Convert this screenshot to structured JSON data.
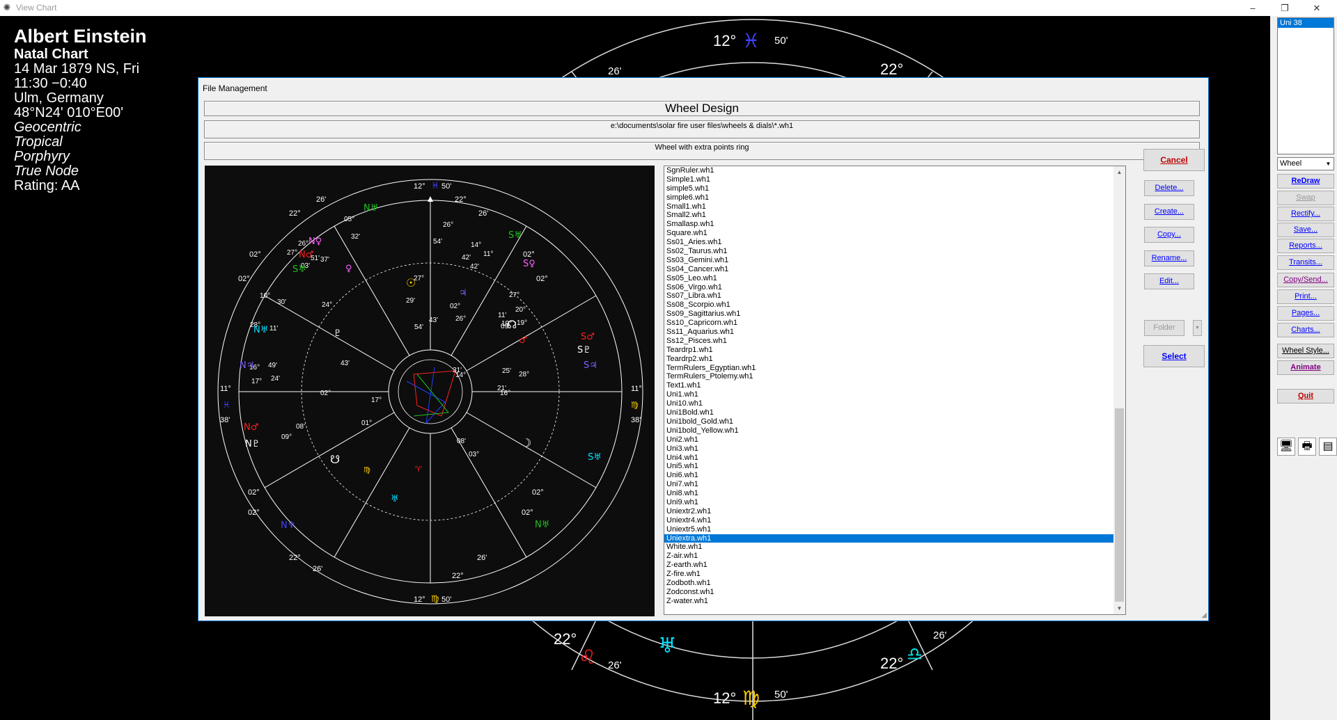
{
  "window": {
    "title": "View Chart",
    "minimize": "–",
    "restore": "❐",
    "close": "✕"
  },
  "chart_info": {
    "name": "Albert Einstein",
    "type": "Natal Chart",
    "date": "14 Mar 1879 NS, Fri",
    "time": "11:30  −0:40",
    "place": "Ulm, Germany",
    "coords": "48°N24' 010°E00'",
    "perspective": "Geocentric",
    "zodiac": "Tropical",
    "houses": "Porphyry",
    "node": "True Node",
    "rating": "Rating: AA"
  },
  "bg_wheel": {
    "top_deg": "12°",
    "top_min": "50'",
    "top_sign": "♓",
    "top_left": "26'",
    "top_right": "22°",
    "bottom_deg": "12°",
    "bottom_min": "50'",
    "bottom_sign": "♍",
    "bl_deg": "22°",
    "bl_sign": "♌",
    "bl_min": "26'",
    "bm_sign": "♅",
    "br_deg": "22°",
    "br_sign": "♎",
    "br_min": "26'"
  },
  "right_panel": {
    "listbox_selected": "Uni 38",
    "wheel_select": "Wheel",
    "buttons": {
      "redraw": "ReDraw",
      "swap": "Swap",
      "rectify": "Rectify...",
      "save": "Save...",
      "reports": "Reports...",
      "transits": "Transits...",
      "copysend": "Copy/Send...",
      "print": "Print...",
      "pages": "Pages...",
      "charts": "Charts...",
      "wheelstyle": "Wheel Style...",
      "animate": "Animate",
      "quit": "Quit"
    },
    "icons": [
      "monitor-icon",
      "printer-icon",
      "page-icon"
    ]
  },
  "dialog": {
    "title": "File Management",
    "heading": "Wheel Design",
    "path": "e:\\documents\\solar fire user files\\wheels & dials\\*.wh1",
    "description": "Wheel with extra points ring",
    "files": [
      "SgnRuler.wh1",
      "Simple1.wh1",
      "simple5.wh1",
      "simple6.wh1",
      "Small1.wh1",
      "Small2.wh1",
      "Smallasp.wh1",
      "Square.wh1",
      "Ss01_Aries.wh1",
      "Ss02_Taurus.wh1",
      "Ss03_Gemini.wh1",
      "Ss04_Cancer.wh1",
      "Ss05_Leo.wh1",
      "Ss06_Virgo.wh1",
      "Ss07_Libra.wh1",
      "Ss08_Scorpio.wh1",
      "Ss09_Sagittarius.wh1",
      "Ss10_Capricorn.wh1",
      "Ss11_Aquarius.wh1",
      "Ss12_Pisces.wh1",
      "Teardrp1.wh1",
      "Teardrp2.wh1",
      "TermRulers_Egyptian.wh1",
      "TermRulers_Ptolemy.wh1",
      "Text1.wh1",
      "Uni1.wh1",
      "Uni10.wh1",
      "Uni1Bold.wh1",
      "Uni1bold_Gold.wh1",
      "Uni1bold_Yellow.wh1",
      "Uni2.wh1",
      "Uni3.wh1",
      "Uni4.wh1",
      "Uni5.wh1",
      "Uni6.wh1",
      "Uni7.wh1",
      "Uni8.wh1",
      "Uni9.wh1",
      "Uniextr2.wh1",
      "Uniextr4.wh1",
      "Uniextr5.wh1",
      "Uniextra.wh1",
      "White.wh1",
      "Z-air.wh1",
      "Z-earth.wh1",
      "Z-fire.wh1",
      "Zodboth.wh1",
      "Zodconst.wh1",
      "Z-water.wh1"
    ],
    "selected_file": "Uniextra.wh1",
    "buttons": {
      "cancel": "Cancel",
      "delete": "Delete...",
      "create": "Create...",
      "copy": "Copy...",
      "rename": "Rename...",
      "edit": "Edit...",
      "folder": "Folder",
      "select": "Select"
    }
  },
  "preview_wheel": {
    "cusp_top": "12°",
    "cusp_top_min": "50'",
    "cusp_bottom": "12°",
    "cusp_bottom_min": "50'",
    "left_deg": "11°",
    "left_min": "38'",
    "right_deg": "11°",
    "right_min": "38'",
    "labels": [
      {
        "t": "26'"
      },
      {
        "t": "22°"
      },
      {
        "t": "22°"
      },
      {
        "t": "26'"
      },
      {
        "t": "02°"
      },
      {
        "t": "02°"
      },
      {
        "t": "02°"
      },
      {
        "t": "02°"
      },
      {
        "t": "02°"
      },
      {
        "t": "02°"
      },
      {
        "t": "02°"
      },
      {
        "t": "02°"
      },
      {
        "t": "22°"
      },
      {
        "t": "26'"
      },
      {
        "t": "22°"
      },
      {
        "t": "26'"
      }
    ],
    "planets": [
      {
        "t": "05°",
        "c": "#ffffff"
      },
      {
        "t": "32'",
        "c": "#ffffff"
      },
      {
        "t": "26°",
        "c": "#ffffff"
      },
      {
        "t": "51'",
        "c": "#ffffff"
      },
      {
        "t": "27°",
        "c": "#ffffff"
      },
      {
        "t": "37'",
        "c": "#ffffff"
      },
      {
        "t": "03'",
        "c": "#ffffff"
      },
      {
        "t": "26°",
        "c": "#ffffff"
      },
      {
        "t": "54'",
        "c": "#ffffff"
      },
      {
        "t": "14°",
        "c": "#ffffff"
      },
      {
        "t": "11°",
        "c": "#ffffff"
      },
      {
        "t": "42'",
        "c": "#ffffff"
      },
      {
        "t": "42'",
        "c": "#ffffff"
      },
      {
        "t": "27°",
        "c": "#ffffff"
      },
      {
        "t": "29'",
        "c": "#ffffff"
      },
      {
        "t": "10°",
        "c": "#ffffff"
      },
      {
        "t": "30'",
        "c": "#ffffff"
      },
      {
        "t": "28°",
        "c": "#ffffff"
      },
      {
        "t": "11'",
        "c": "#ffffff"
      },
      {
        "t": "16°",
        "c": "#ffffff"
      },
      {
        "t": "49'",
        "c": "#ffffff"
      },
      {
        "t": "17°",
        "c": "#ffffff"
      },
      {
        "t": "24'",
        "c": "#ffffff"
      },
      {
        "t": "24°",
        "c": "#ffffff"
      },
      {
        "t": "43'",
        "c": "#ffffff"
      },
      {
        "t": "02°",
        "c": "#ffffff"
      },
      {
        "t": "09°",
        "c": "#ffffff"
      },
      {
        "t": "08'",
        "c": "#ffffff"
      },
      {
        "t": "17°",
        "c": "#ffffff"
      },
      {
        "t": "01°",
        "c": "#ffffff"
      },
      {
        "t": "08'",
        "c": "#ffffff"
      },
      {
        "t": "03°",
        "c": "#ffffff"
      },
      {
        "t": "31'",
        "c": "#ffffff"
      },
      {
        "t": "14°",
        "c": "#ffffff"
      },
      {
        "t": "21'",
        "c": "#ffffff"
      },
      {
        "t": "16°",
        "c": "#ffffff"
      },
      {
        "t": "25'",
        "c": "#ffffff"
      },
      {
        "t": "28°",
        "c": "#ffffff"
      },
      {
        "t": "19°",
        "c": "#ffffff"
      },
      {
        "t": "20°",
        "c": "#ffffff"
      },
      {
        "t": "19°",
        "c": "#ffffff"
      },
      {
        "t": "27°",
        "c": "#ffffff"
      },
      {
        "t": "11'",
        "c": "#ffffff"
      },
      {
        "t": "09'",
        "c": "#ffffff"
      },
      {
        "t": "43'",
        "c": "#ffffff"
      },
      {
        "t": "54'",
        "c": "#ffffff"
      },
      {
        "t": "26°",
        "c": "#ffffff"
      },
      {
        "t": "02°",
        "c": "#ffffff"
      }
    ]
  },
  "colors": {
    "accent": "#0078d7",
    "link_blue": "#0000ff",
    "disabled": "#999999",
    "chart_bg": "#000000"
  }
}
